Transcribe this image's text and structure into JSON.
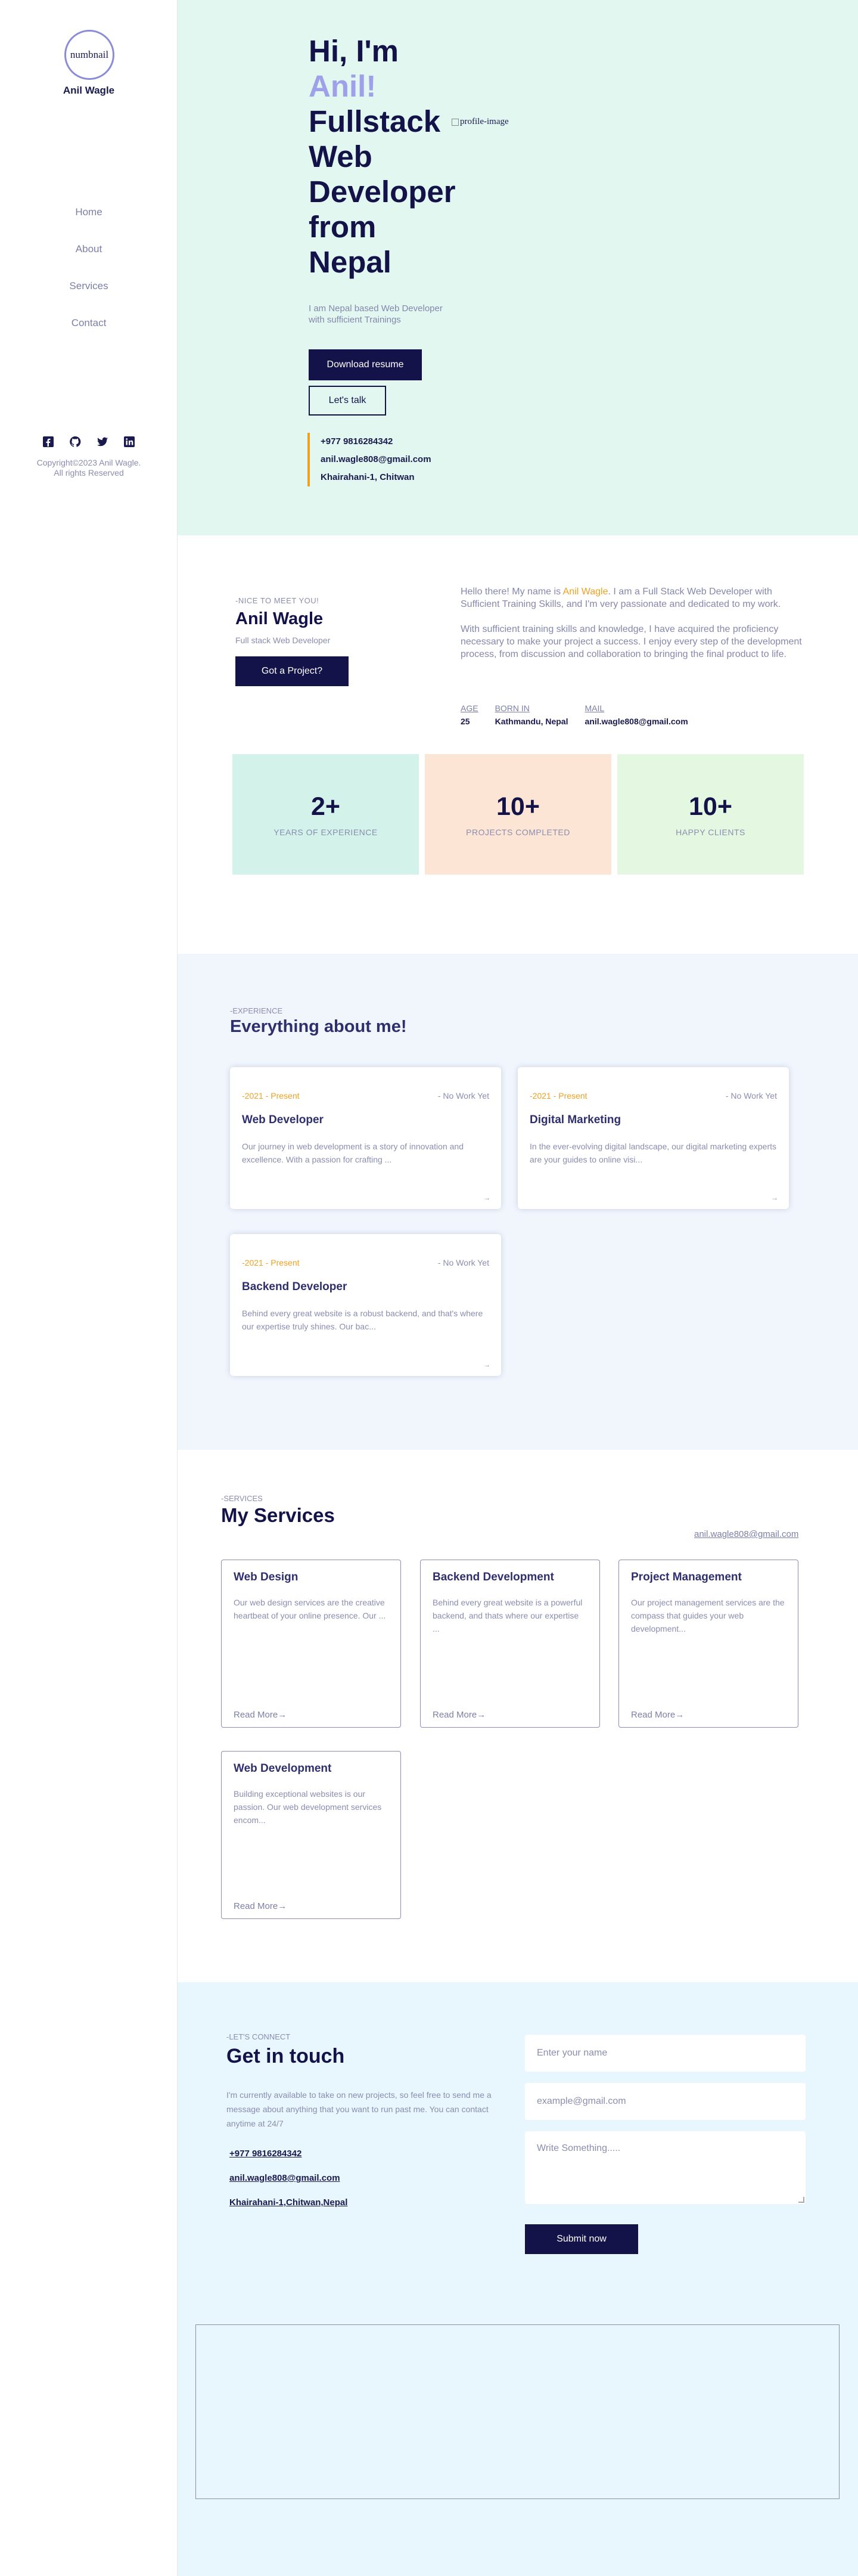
{
  "sidebar": {
    "logo_alt": "numbnail",
    "brand": "Anil Wagle",
    "nav": [
      "Home",
      "About",
      "Services",
      "Contact"
    ],
    "socials": [
      "facebook-icon",
      "github-icon",
      "twitter-icon",
      "linkedin-icon"
    ],
    "copyright_line1": "Copyright©2023 Anil Wagle.",
    "copyright_line2": "All rights Reserved"
  },
  "hero": {
    "greeting": "Hi, I'm",
    "name": "Anil!",
    "line1": "Fullstack",
    "line2": "Web",
    "line3": "Developer",
    "line4": "from",
    "line5": "Nepal",
    "profile_alt": "profile-image",
    "subtitle": "I am Nepal based Web Developer with sufficient Trainings",
    "download_label": "Download resume",
    "talk_label": "Let's talk",
    "phone": "+977 9816284342",
    "email": "anil.wagle808@gmail.com",
    "address": "Khairahani-1, Chitwan"
  },
  "about": {
    "tag": "-NICE TO MEET YOU!",
    "name": "Anil Wagle",
    "role": "Full stack Web Developer",
    "project_label": "Got a Project?",
    "para1_pre": "Hello there! My name is ",
    "para1_name": "Anil Wagle",
    "para1_post": ". I am a Full Stack Web Developer with Sufficient Training Skills, and I'm very passionate and dedicated to my work.",
    "para2": "With sufficient training skills and knowledge, I have acquired the proficiency necessary to make your project a success. I enjoy every step of the development process, from discussion and collaboration to bringing the final product to life.",
    "facts": [
      {
        "key": "AGE",
        "value": "25"
      },
      {
        "key": "BORN IN",
        "value": "Kathmandu, Nepal"
      },
      {
        "key": "MAIL",
        "value": "anil.wagle808@gmail.com"
      }
    ],
    "stats": [
      {
        "num": "2+",
        "label": "YEARS OF EXPERIENCE",
        "bg": "#d3f2ea"
      },
      {
        "num": "10+",
        "label": "PROJECTS COMPLETED",
        "bg": "#fde5d5"
      },
      {
        "num": "10+",
        "label": "HAPPY CLIENTS",
        "bg": "#e4f8e1"
      }
    ]
  },
  "experience": {
    "tag": "-EXPERIENCE",
    "title": "Everything about me!",
    "cards": [
      {
        "date": "-2021 - Present",
        "nowork": "- No Work Yet",
        "title": "Web Developer",
        "desc": "Our journey in web development is a story of innovation and excellence. With a passion for crafting ...",
        "arrow": "→"
      },
      {
        "date": "-2021 - Present",
        "nowork": "- No Work Yet",
        "title": "Digital Marketing",
        "desc": "In the ever-evolving digital landscape, our digital marketing experts are your guides to online visi...",
        "arrow": "→"
      },
      {
        "date": "-2021 - Present",
        "nowork": "- No Work Yet",
        "title": "Backend Developer",
        "desc": "Behind every great website is a robust backend, and that's where our expertise truly shines. Our bac...",
        "arrow": "→"
      }
    ]
  },
  "services": {
    "tag": "-SERVICES",
    "title": "My Services",
    "email": "anil.wagle808@gmail.com",
    "cards": [
      {
        "title": "Web Design",
        "desc": "Our web design services are the creative heartbeat of your online presence. Our ...",
        "more": "Read More→"
      },
      {
        "title": "Backend Development",
        "desc": "Behind every great website is a powerful backend, and thats where our expertise ...",
        "more": "Read More→"
      },
      {
        "title": "Project Management",
        "desc": "Our project management services are the compass that guides your web development...",
        "more": "Read More→"
      },
      {
        "title": "Web Development",
        "desc": "Building exceptional websites is our passion. Our web development services encom...",
        "more": "Read More→"
      }
    ]
  },
  "contact": {
    "tag": "-LET'S CONNECT",
    "title": "Get in touch",
    "text": "I'm currently available to take on new projects, so feel free to send me a message about anything that you want to run past me. You can contact anytime at 24/7",
    "phone": "+977 9816284342",
    "email": "anil.wagle808@gmail.com",
    "address": "Khairahani-1,Chitwan,Nepal",
    "name_placeholder": "Enter your name",
    "email_placeholder": "example@gmail.com",
    "message_placeholder": "Write Something.....",
    "submit_label": "Submit now"
  }
}
